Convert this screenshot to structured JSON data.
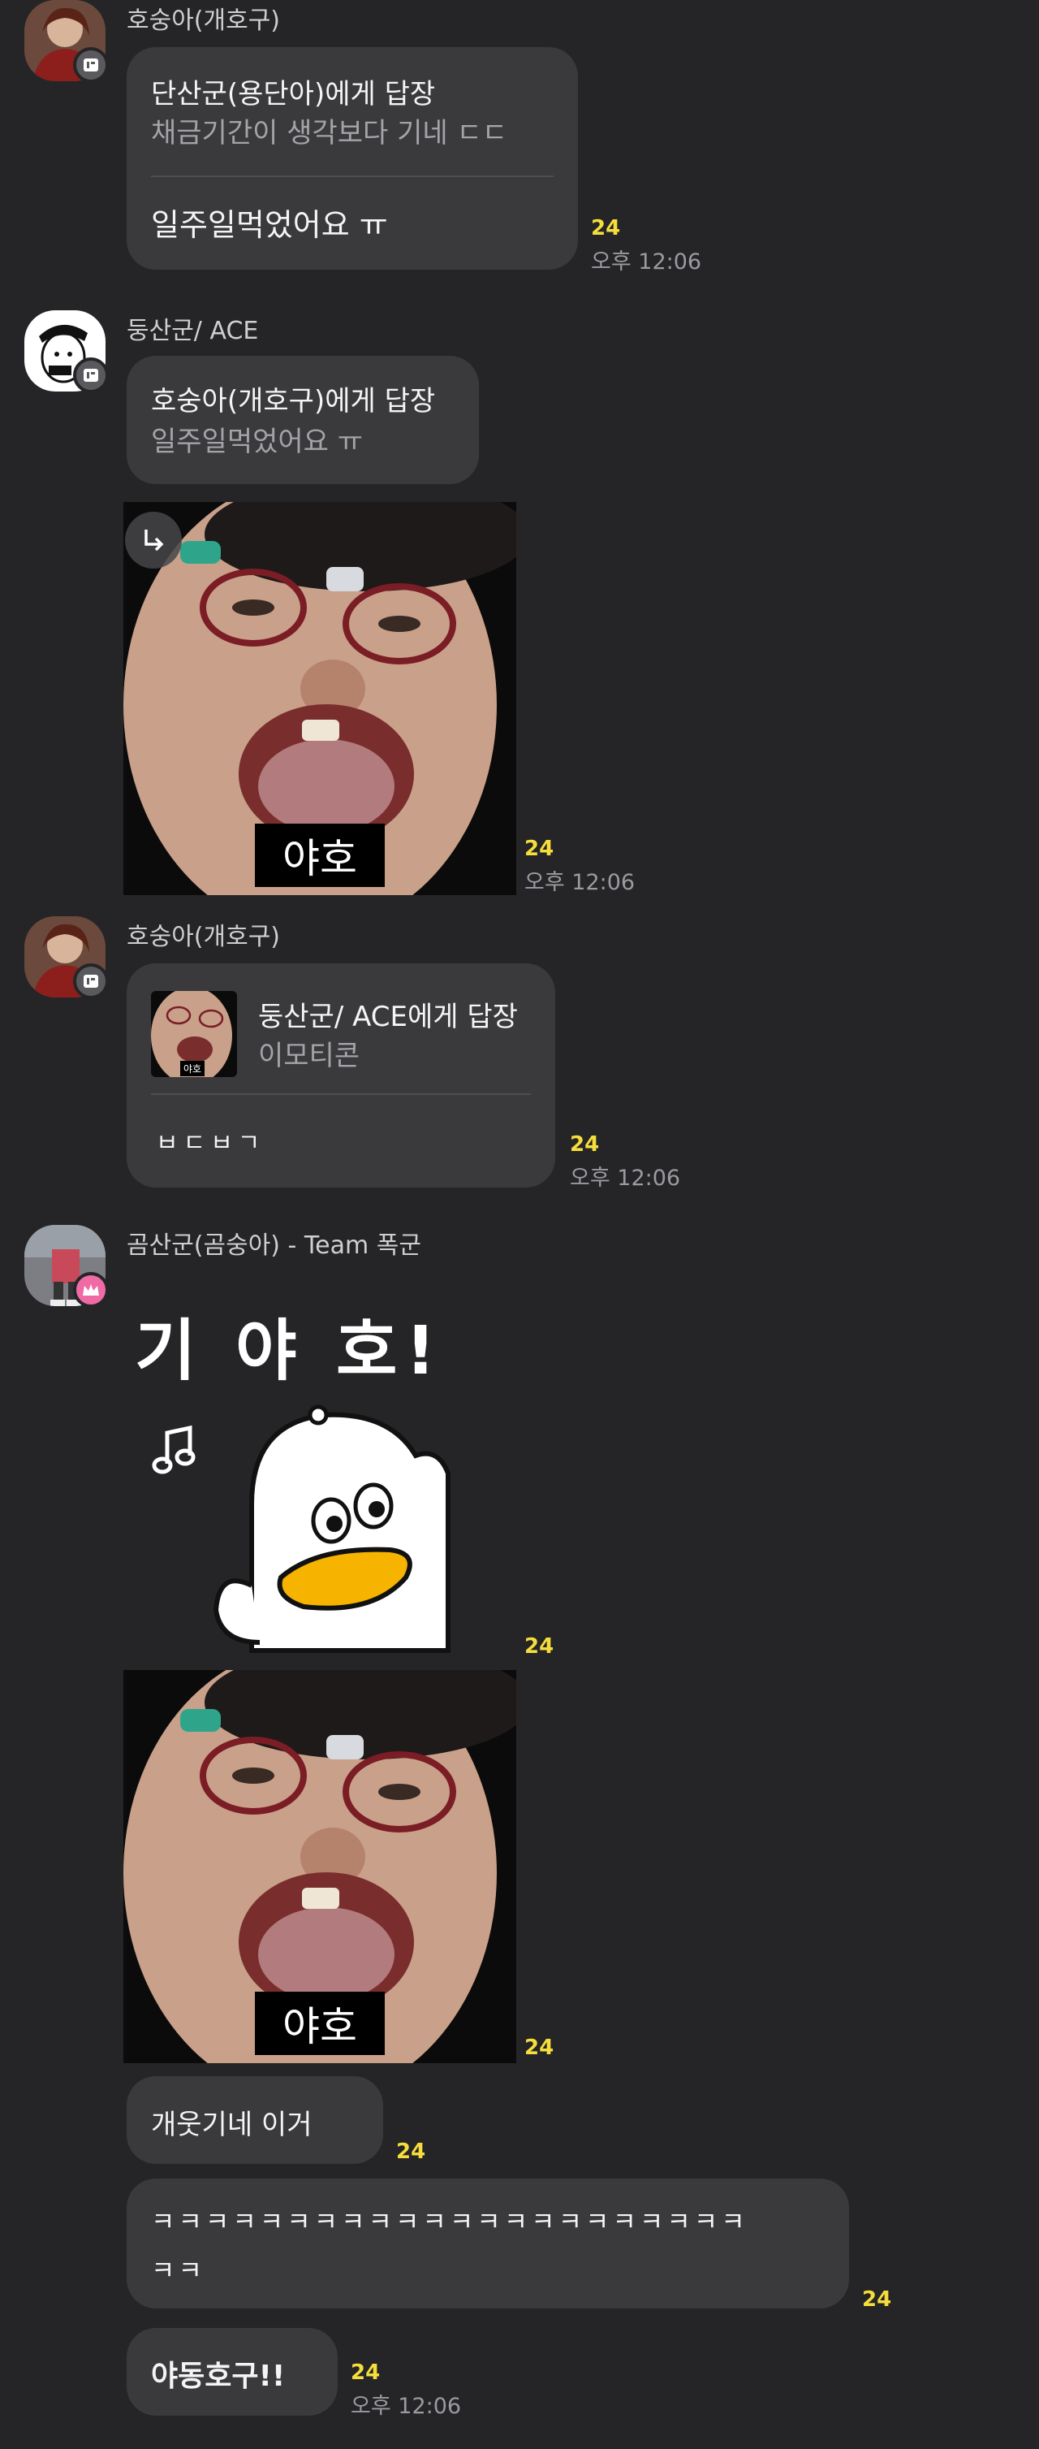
{
  "messages": {
    "m1": {
      "sender": "호숭아(개호구)",
      "reply_title": "단산군(용단아)에게 답장",
      "reply_quote": "채금기간이 생각보다 기네 ㄷㄷ",
      "text": "일주일먹었어요 ㅠ",
      "count": "24",
      "time": "오후 12:06"
    },
    "m2": {
      "sender": "둥산군/ ACE",
      "reply_title": "호숭아(개호구)에게 답장",
      "reply_quote": "일주일먹었어요 ㅠ"
    },
    "m3": {
      "caption": "야호",
      "count": "24",
      "time": "오후 12:06"
    },
    "m4": {
      "sender": "호숭아(개호구)",
      "thumb_caption": "야호",
      "reply_title": "둥산군/ ACE에게 답장",
      "reply_quote": "이모티콘",
      "text": "ㅂㄷㅂㄱ",
      "count": "24",
      "time": "오후 12:06"
    },
    "m5": {
      "sender": "곰산군(곰숭아) - Team 폭군",
      "sticker_text": "기 야 호!",
      "count": "24"
    },
    "m6": {
      "caption": "야호",
      "count": "24"
    },
    "m7": {
      "text": "개웃기네 이거",
      "count": "24"
    },
    "m8": {
      "line1": "ㅋㅋㅋㅋㅋㅋㅋㅋㅋㅋㅋㅋㅋㅋㅋㅋㅋㅋㅋㅋㅋㅋ",
      "line2": "ㅋㅋ",
      "count": "24"
    },
    "m9": {
      "text": "야동호구!!",
      "count": "24",
      "time": "오후 12:06"
    }
  },
  "icons": {
    "share": "share-arrow-icon",
    "badge": "manager-badge-icon",
    "crown": "crown-icon"
  },
  "colors": {
    "background": "#252527",
    "bubble": "#3a3a3d",
    "unread_count": "#f5de3b",
    "owner_badge": "#f06aa6"
  }
}
